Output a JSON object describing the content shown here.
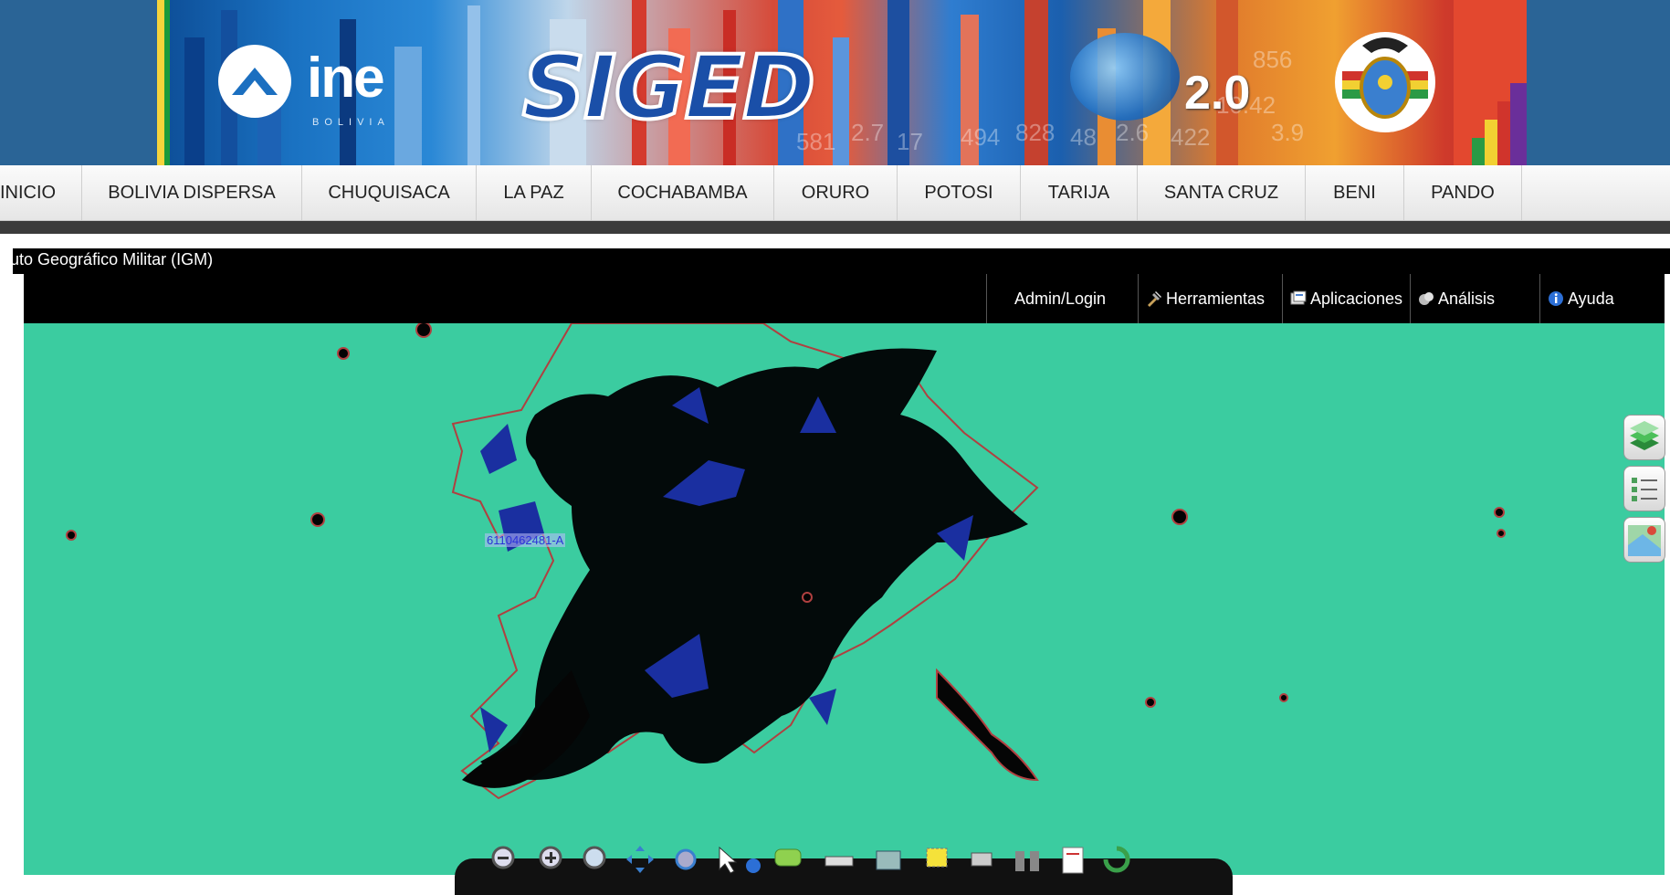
{
  "banner": {
    "ine_logo": "ine",
    "ine_country": "BOLIVIA",
    "title": "SIGED",
    "version": "2.0",
    "bg_numbers": [
      "581",
      "2.7",
      "17",
      "494",
      "828",
      "48",
      "2.6",
      "422",
      "10.42",
      "856",
      "3.9"
    ],
    "coat_of_arms_icon": "bolivia-coat-of-arms-icon"
  },
  "nav": {
    "items": [
      "INICIO",
      "BOLIVIA DISPERSA",
      "CHUQUISACA",
      "LA PAZ",
      "COCHABAMBA",
      "ORURO",
      "POTOSI",
      "TARIJA",
      "SANTA CRUZ",
      "BENI",
      "PANDO"
    ]
  },
  "app": {
    "title": "tuto Geográfico Militar (IGM)",
    "menu": [
      {
        "label": "Admin/Login",
        "icon": ""
      },
      {
        "label": "Herramientas",
        "icon": "tools-icon"
      },
      {
        "label": "Aplicaciones",
        "icon": "applications-icon"
      },
      {
        "label": "Análisis",
        "icon": "analysis-icon"
      },
      {
        "label": "Ayuda",
        "icon": "info-icon"
      }
    ]
  },
  "map": {
    "feature_label": "6110462481-A",
    "colors": {
      "background": "#3bcca0",
      "built_area": "#000000",
      "block_fill": "#1a2fa0",
      "boundary": "#b04040"
    },
    "side_tools": [
      "layers-icon",
      "legend-icon",
      "map-marker-icon"
    ],
    "toolbar_tools": [
      "zoom-out-icon",
      "zoom-in-icon",
      "zoom-box-icon",
      "pan-icon",
      "full-extent-icon",
      "select-pointer-icon",
      "identify-icon",
      "comment-icon",
      "measure-icon",
      "layer-manager-icon",
      "select-box-icon",
      "print-icon",
      "binoculars-icon",
      "report-icon",
      "refresh-icon"
    ]
  }
}
